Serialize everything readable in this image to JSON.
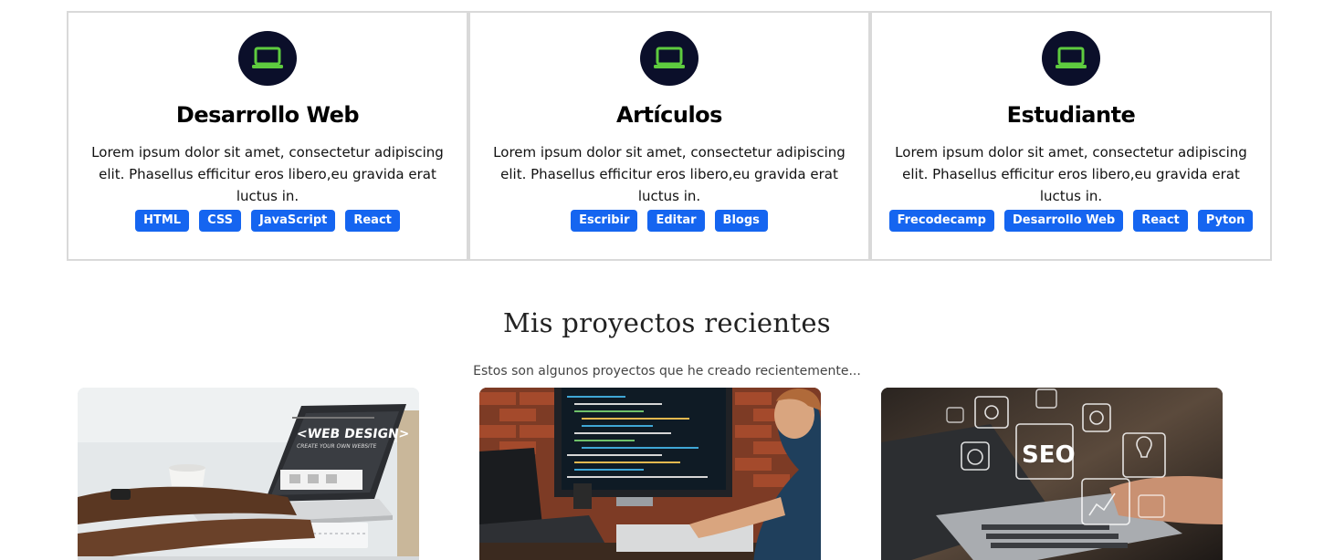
{
  "cards": [
    {
      "title": "Desarrollo Web",
      "text": "Lorem ipsum dolor sit amet, consectetur adipiscing elit. Phasellus efficitur eros libero,eu gravida erat luctus in.",
      "icon": "laptop-icon",
      "tags": [
        "HTML",
        "CSS",
        "JavaScript",
        "React"
      ]
    },
    {
      "title": "Artículos",
      "text": "Lorem ipsum dolor sit amet, consectetur adipiscing elit. Phasellus efficitur eros libero,eu gravida erat luctus in.",
      "icon": "laptop-icon",
      "tags": [
        "Escribir",
        "Editar",
        "Blogs"
      ]
    },
    {
      "title": "Estudiante",
      "text": "Lorem ipsum dolor sit amet, consectetur adipiscing elit. Phasellus efficitur eros libero,eu gravida erat luctus in.",
      "icon": "laptop-icon",
      "tags": [
        "Frecodecamp",
        "Desarrollo Web",
        "React",
        "Pyton"
      ]
    }
  ],
  "projects_section": {
    "title": "Mis proyectos recientes",
    "subtitle": "Estos son algunos proyectos que he creado recientemente..."
  },
  "project_images": [
    {
      "name": "web-design-laptop-image",
      "screen_title": "<WEB DESIGN>",
      "screen_subtitle": "CREATE YOUR OWN WEBSITE"
    },
    {
      "name": "developer-coding-image"
    },
    {
      "name": "seo-laptop-image",
      "badge": "SEO"
    }
  ],
  "colors": {
    "icon_circle": "#0b0f2a",
    "icon_green": "#5ecb3f",
    "tag_blue": "#1565f0",
    "card_border": "#d9d9d9"
  }
}
